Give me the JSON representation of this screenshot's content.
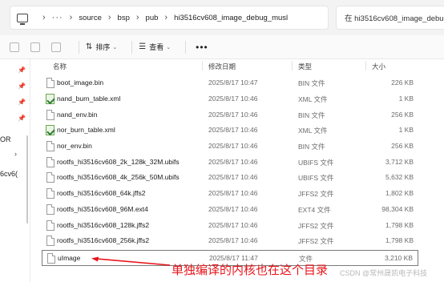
{
  "address_bar": {
    "crumbs": [
      "source",
      "bsp",
      "pub",
      "hi3516cv608_image_debug_musl"
    ],
    "search_placeholder": "在 hi3516cv608_image_debu"
  },
  "toolbar": {
    "sort_label": "排序",
    "view_label": "查看",
    "more_label": "•••"
  },
  "nav": {
    "partial_items": [
      "OR",
      "6cv6("
    ]
  },
  "columns": {
    "name": "名称",
    "date": "修改日期",
    "type": "类型",
    "size": "大小"
  },
  "files": [
    {
      "name": "boot_image.bin",
      "date": "2025/8/17 10:47",
      "type": "BIN 文件",
      "size": "226 KB",
      "icon": "bin-file-icon"
    },
    {
      "name": "nand_burn_table.xml",
      "date": "2025/8/17 10:46",
      "type": "XML 文件",
      "size": "1 KB",
      "icon": "xml-file-icon"
    },
    {
      "name": "nand_env.bin",
      "date": "2025/8/17 10:46",
      "type": "BIN 文件",
      "size": "256 KB",
      "icon": "bin-file-icon"
    },
    {
      "name": "nor_burn_table.xml",
      "date": "2025/8/17 10:46",
      "type": "XML 文件",
      "size": "1 KB",
      "icon": "xml-file-icon"
    },
    {
      "name": "nor_env.bin",
      "date": "2025/8/17 10:46",
      "type": "BIN 文件",
      "size": "256 KB",
      "icon": "bin-file-icon"
    },
    {
      "name": "rootfs_hi3516cv608_2k_128k_32M.ubifs",
      "date": "2025/8/17 10:46",
      "type": "UBIFS 文件",
      "size": "3,712 KB",
      "icon": "file-icon"
    },
    {
      "name": "rootfs_hi3516cv608_4k_256k_50M.ubifs",
      "date": "2025/8/17 10:46",
      "type": "UBIFS 文件",
      "size": "5,632 KB",
      "icon": "file-icon"
    },
    {
      "name": "rootfs_hi3516cv608_64k.jffs2",
      "date": "2025/8/17 10:46",
      "type": "JFFS2 文件",
      "size": "1,802 KB",
      "icon": "file-icon"
    },
    {
      "name": "rootfs_hi3516cv608_96M.ext4",
      "date": "2025/8/17 10:46",
      "type": "EXT4 文件",
      "size": "98,304 KB",
      "icon": "file-icon"
    },
    {
      "name": "rootfs_hi3516cv608_128k.jffs2",
      "date": "2025/8/17 10:46",
      "type": "JFFS2 文件",
      "size": "1,798 KB",
      "icon": "file-icon"
    },
    {
      "name": "rootfs_hi3516cv608_256k.jffs2",
      "date": "2025/8/17 10:46",
      "type": "JFFS2 文件",
      "size": "1,798 KB",
      "icon": "file-icon"
    },
    {
      "name": "uImage",
      "date": "2025/8/17 11:47",
      "type": "文件",
      "size": "3,210 KB",
      "icon": "file-icon"
    }
  ],
  "annotation": {
    "text": "单独编译的内核也在这个目录",
    "color": "#e8141b"
  },
  "watermark": "CSDN @常州晟凯电子科技"
}
